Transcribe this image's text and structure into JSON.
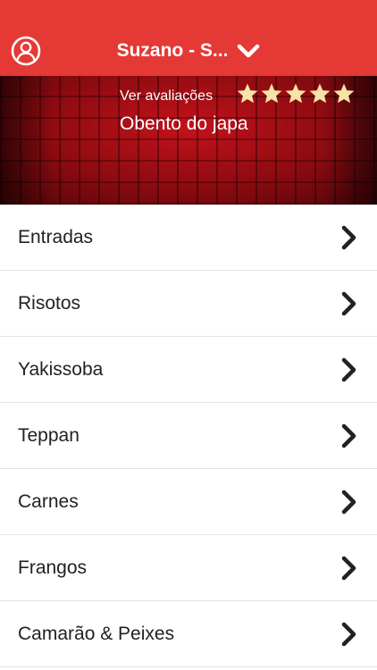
{
  "header": {
    "location_label": "Suzano - S...",
    "profile_icon": "user-circle-icon",
    "dropdown_icon": "chevron-down-icon",
    "background_color": "#e53935"
  },
  "restaurant": {
    "reviews_link": "Ver avaliações",
    "name": "Obento do japa",
    "rating": 5,
    "rating_max": 5,
    "star_color": "#f7e3a8"
  },
  "menu": {
    "items": [
      {
        "label": "Entradas"
      },
      {
        "label": "Risotos"
      },
      {
        "label": "Yakissoba"
      },
      {
        "label": "Teppan"
      },
      {
        "label": "Carnes"
      },
      {
        "label": "Frangos"
      },
      {
        "label": "Camarão & Peixes"
      }
    ],
    "arrow_icon": "chevron-right-icon"
  }
}
